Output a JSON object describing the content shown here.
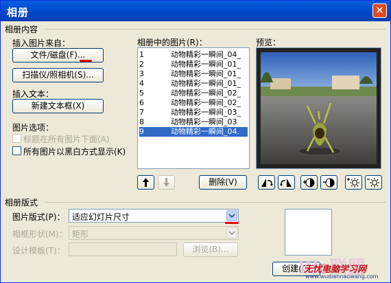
{
  "window": {
    "title": "相册",
    "close_label": "✕"
  },
  "album_content": {
    "group_label": "相册内容",
    "insert_picture_from": "插入图片来自：",
    "file_disk_button": "文件/磁盘(F)...",
    "scanner_camera_button": "扫描仪/照相机(S)...",
    "insert_text": "插入文本：",
    "new_text_box_button": "新建文本框(X)",
    "picture_options": "图片选项：",
    "caption_below": "标题在所有图片下面(A)",
    "caption_below_checked": false,
    "black_white": "所有图片以黑白方式显示(K)",
    "black_white_checked": false
  },
  "pictures": {
    "label": "相册中的图片(R)：",
    "items": [
      {
        "num": "1",
        "name": "动物精彩一瞬间_04_"
      },
      {
        "num": "2",
        "name": "动物精彩一瞬间_01_"
      },
      {
        "num": "3",
        "name": "动物精彩一瞬间_01_"
      },
      {
        "num": "4",
        "name": "动物精彩一瞬间_01_"
      },
      {
        "num": "5",
        "name": "动物精彩一瞬间_02_"
      },
      {
        "num": "6",
        "name": "动物精彩一瞬间_02_"
      },
      {
        "num": "7",
        "name": "动物精彩一瞬间_03_"
      },
      {
        "num": "8",
        "name": "动物精彩一瞬间_03"
      },
      {
        "num": "9",
        "name": "动物精彩一瞬间_04."
      }
    ],
    "selected_index": 8,
    "delete_button": "删除(V)"
  },
  "preview": {
    "label": "预览："
  },
  "album_layout": {
    "group_label": "相册版式",
    "picture_layout_label": "图片版式(P)：",
    "picture_layout_value": "适应幻灯片尺寸",
    "frame_shape_label": "相框形状(M)：",
    "frame_shape_value": "矩形",
    "design_template_label": "设计模板(T)：",
    "browse_button": "浏览(B)...",
    "create_button": "创建(C)"
  },
  "watermark": {
    "text": "无忧电脑学习网",
    "sub": "www.wudiannaowang.com"
  },
  "colors": {
    "titlebar": "#0046c8",
    "selection": "#316ac5",
    "annotation": "#e00000"
  }
}
